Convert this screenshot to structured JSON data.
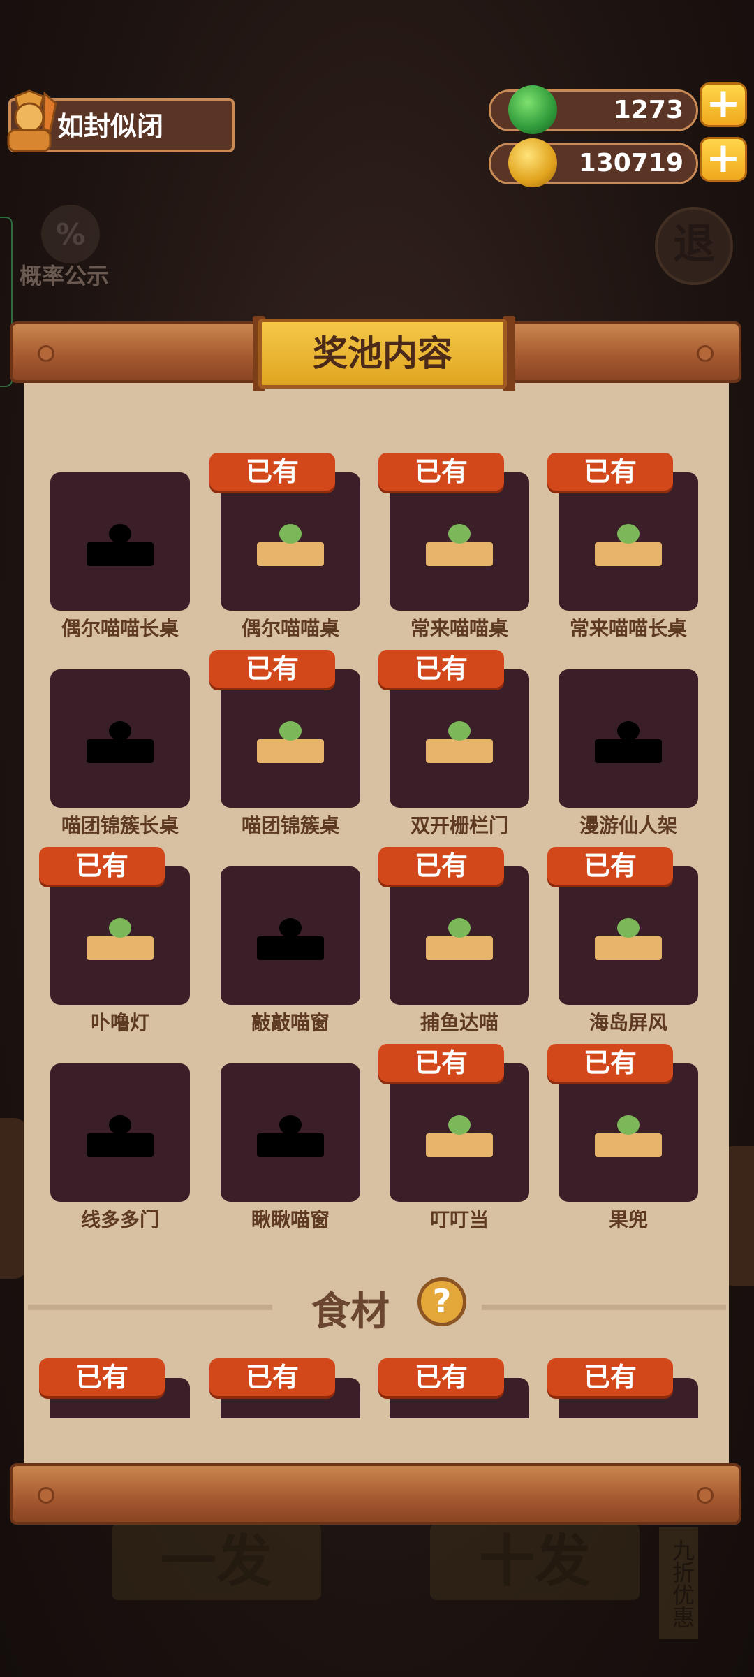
{
  "header": {
    "username": "如封似闭",
    "jade": "1273",
    "coins": "130719"
  },
  "probability_label": "概率公示",
  "exit_label": "退",
  "panel_title": "奖池内容",
  "owned_label": "已有",
  "items": [
    {
      "name": "偶尔喵喵长桌",
      "owned": false
    },
    {
      "name": "偶尔喵喵桌",
      "owned": true
    },
    {
      "name": "常来喵喵桌",
      "owned": true
    },
    {
      "name": "常来喵喵长桌",
      "owned": true
    },
    {
      "name": "喵团锦簇长桌",
      "owned": false
    },
    {
      "name": "喵团锦簇桌",
      "owned": true
    },
    {
      "name": "双开栅栏门",
      "owned": true
    },
    {
      "name": "漫游仙人架",
      "owned": false
    },
    {
      "name": "卟噜灯",
      "owned": true
    },
    {
      "name": "敲敲喵窗",
      "owned": false
    },
    {
      "name": "捕鱼达喵",
      "owned": true
    },
    {
      "name": "海岛屏风",
      "owned": true
    },
    {
      "name": "线多多门",
      "owned": false
    },
    {
      "name": "瞅瞅喵窗",
      "owned": false
    },
    {
      "name": "叮叮当",
      "owned": true
    },
    {
      "name": "果兜",
      "owned": true
    }
  ],
  "section_food": "食材",
  "help_symbol": "?",
  "bottom": {
    "single": "一发",
    "ten": "十发",
    "discount": "九折优惠"
  }
}
